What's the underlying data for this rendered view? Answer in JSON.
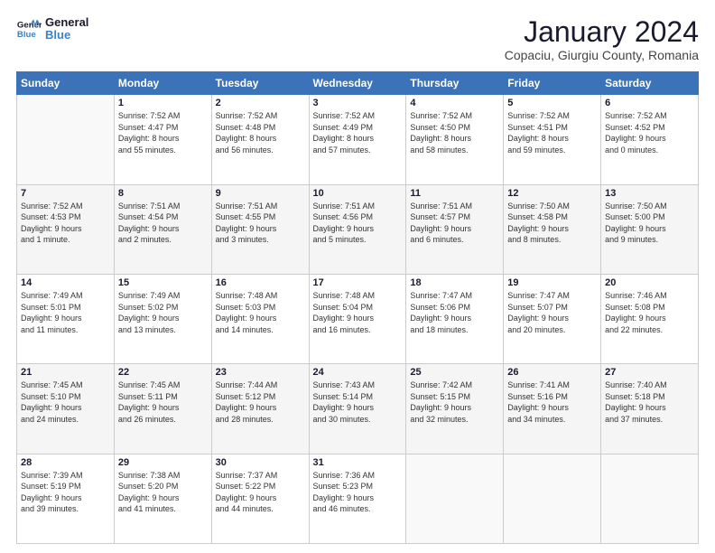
{
  "header": {
    "logo_line1": "General",
    "logo_line2": "Blue",
    "title": "January 2024",
    "subtitle": "Copaciu, Giurgiu County, Romania"
  },
  "columns": [
    "Sunday",
    "Monday",
    "Tuesday",
    "Wednesday",
    "Thursday",
    "Friday",
    "Saturday"
  ],
  "weeks": [
    [
      {
        "day": "",
        "info": ""
      },
      {
        "day": "1",
        "info": "Sunrise: 7:52 AM\nSunset: 4:47 PM\nDaylight: 8 hours\nand 55 minutes."
      },
      {
        "day": "2",
        "info": "Sunrise: 7:52 AM\nSunset: 4:48 PM\nDaylight: 8 hours\nand 56 minutes."
      },
      {
        "day": "3",
        "info": "Sunrise: 7:52 AM\nSunset: 4:49 PM\nDaylight: 8 hours\nand 57 minutes."
      },
      {
        "day": "4",
        "info": "Sunrise: 7:52 AM\nSunset: 4:50 PM\nDaylight: 8 hours\nand 58 minutes."
      },
      {
        "day": "5",
        "info": "Sunrise: 7:52 AM\nSunset: 4:51 PM\nDaylight: 8 hours\nand 59 minutes."
      },
      {
        "day": "6",
        "info": "Sunrise: 7:52 AM\nSunset: 4:52 PM\nDaylight: 9 hours\nand 0 minutes."
      }
    ],
    [
      {
        "day": "7",
        "info": "Sunrise: 7:52 AM\nSunset: 4:53 PM\nDaylight: 9 hours\nand 1 minute."
      },
      {
        "day": "8",
        "info": "Sunrise: 7:51 AM\nSunset: 4:54 PM\nDaylight: 9 hours\nand 2 minutes."
      },
      {
        "day": "9",
        "info": "Sunrise: 7:51 AM\nSunset: 4:55 PM\nDaylight: 9 hours\nand 3 minutes."
      },
      {
        "day": "10",
        "info": "Sunrise: 7:51 AM\nSunset: 4:56 PM\nDaylight: 9 hours\nand 5 minutes."
      },
      {
        "day": "11",
        "info": "Sunrise: 7:51 AM\nSunset: 4:57 PM\nDaylight: 9 hours\nand 6 minutes."
      },
      {
        "day": "12",
        "info": "Sunrise: 7:50 AM\nSunset: 4:58 PM\nDaylight: 9 hours\nand 8 minutes."
      },
      {
        "day": "13",
        "info": "Sunrise: 7:50 AM\nSunset: 5:00 PM\nDaylight: 9 hours\nand 9 minutes."
      }
    ],
    [
      {
        "day": "14",
        "info": "Sunrise: 7:49 AM\nSunset: 5:01 PM\nDaylight: 9 hours\nand 11 minutes."
      },
      {
        "day": "15",
        "info": "Sunrise: 7:49 AM\nSunset: 5:02 PM\nDaylight: 9 hours\nand 13 minutes."
      },
      {
        "day": "16",
        "info": "Sunrise: 7:48 AM\nSunset: 5:03 PM\nDaylight: 9 hours\nand 14 minutes."
      },
      {
        "day": "17",
        "info": "Sunrise: 7:48 AM\nSunset: 5:04 PM\nDaylight: 9 hours\nand 16 minutes."
      },
      {
        "day": "18",
        "info": "Sunrise: 7:47 AM\nSunset: 5:06 PM\nDaylight: 9 hours\nand 18 minutes."
      },
      {
        "day": "19",
        "info": "Sunrise: 7:47 AM\nSunset: 5:07 PM\nDaylight: 9 hours\nand 20 minutes."
      },
      {
        "day": "20",
        "info": "Sunrise: 7:46 AM\nSunset: 5:08 PM\nDaylight: 9 hours\nand 22 minutes."
      }
    ],
    [
      {
        "day": "21",
        "info": "Sunrise: 7:45 AM\nSunset: 5:10 PM\nDaylight: 9 hours\nand 24 minutes."
      },
      {
        "day": "22",
        "info": "Sunrise: 7:45 AM\nSunset: 5:11 PM\nDaylight: 9 hours\nand 26 minutes."
      },
      {
        "day": "23",
        "info": "Sunrise: 7:44 AM\nSunset: 5:12 PM\nDaylight: 9 hours\nand 28 minutes."
      },
      {
        "day": "24",
        "info": "Sunrise: 7:43 AM\nSunset: 5:14 PM\nDaylight: 9 hours\nand 30 minutes."
      },
      {
        "day": "25",
        "info": "Sunrise: 7:42 AM\nSunset: 5:15 PM\nDaylight: 9 hours\nand 32 minutes."
      },
      {
        "day": "26",
        "info": "Sunrise: 7:41 AM\nSunset: 5:16 PM\nDaylight: 9 hours\nand 34 minutes."
      },
      {
        "day": "27",
        "info": "Sunrise: 7:40 AM\nSunset: 5:18 PM\nDaylight: 9 hours\nand 37 minutes."
      }
    ],
    [
      {
        "day": "28",
        "info": "Sunrise: 7:39 AM\nSunset: 5:19 PM\nDaylight: 9 hours\nand 39 minutes."
      },
      {
        "day": "29",
        "info": "Sunrise: 7:38 AM\nSunset: 5:20 PM\nDaylight: 9 hours\nand 41 minutes."
      },
      {
        "day": "30",
        "info": "Sunrise: 7:37 AM\nSunset: 5:22 PM\nDaylight: 9 hours\nand 44 minutes."
      },
      {
        "day": "31",
        "info": "Sunrise: 7:36 AM\nSunset: 5:23 PM\nDaylight: 9 hours\nand 46 minutes."
      },
      {
        "day": "",
        "info": ""
      },
      {
        "day": "",
        "info": ""
      },
      {
        "day": "",
        "info": ""
      }
    ]
  ]
}
